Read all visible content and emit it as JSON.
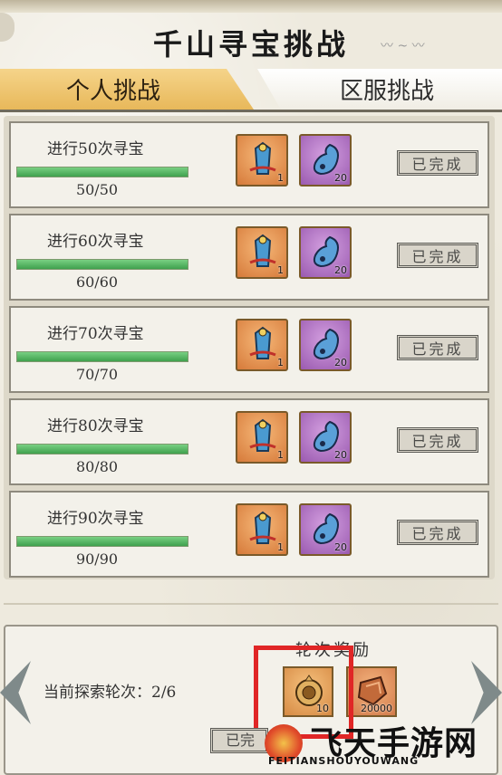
{
  "title": "千山寻宝挑战",
  "tabs": [
    {
      "label": "个人挑战",
      "active": true
    },
    {
      "label": "区服挑战",
      "active": false
    }
  ],
  "challenges": [
    {
      "label": "进行50次寻宝",
      "progress_text": "50/50",
      "progress": 1.0,
      "rewards": [
        {
          "icon": "robe-item-icon",
          "count": "1"
        },
        {
          "icon": "gourd-item-icon",
          "count": "20"
        }
      ],
      "status": "已完成"
    },
    {
      "label": "进行60次寻宝",
      "progress_text": "60/60",
      "progress": 1.0,
      "rewards": [
        {
          "icon": "robe-item-icon",
          "count": "1"
        },
        {
          "icon": "gourd-item-icon",
          "count": "20"
        }
      ],
      "status": "已完成"
    },
    {
      "label": "进行70次寻宝",
      "progress_text": "70/70",
      "progress": 1.0,
      "rewards": [
        {
          "icon": "robe-item-icon",
          "count": "1"
        },
        {
          "icon": "gourd-item-icon",
          "count": "20"
        }
      ],
      "status": "已完成"
    },
    {
      "label": "进行80次寻宝",
      "progress_text": "80/80",
      "progress": 1.0,
      "rewards": [
        {
          "icon": "robe-item-icon",
          "count": "1"
        },
        {
          "icon": "gourd-item-icon",
          "count": "20"
        }
      ],
      "status": "已完成"
    },
    {
      "label": "进行90次寻宝",
      "progress_text": "90/90",
      "progress": 1.0,
      "rewards": [
        {
          "icon": "robe-item-icon",
          "count": "1"
        },
        {
          "icon": "gourd-item-icon",
          "count": "20"
        }
      ],
      "status": "已完成"
    }
  ],
  "round": {
    "title": "轮次奖励",
    "label": "当前探索轮次：2/6",
    "rewards": [
      {
        "icon": "compass-item-icon",
        "count": "10"
      },
      {
        "icon": "ore-item-icon",
        "count": "20000"
      }
    ],
    "claim_label": "已完"
  },
  "watermark": {
    "text": "飞天手游网",
    "sub": "FEITIANSHOUYOUWANG"
  },
  "colors": {
    "tab_active": "#e8b85a",
    "progress": "#4fb25c",
    "highlight": "#e02626"
  }
}
